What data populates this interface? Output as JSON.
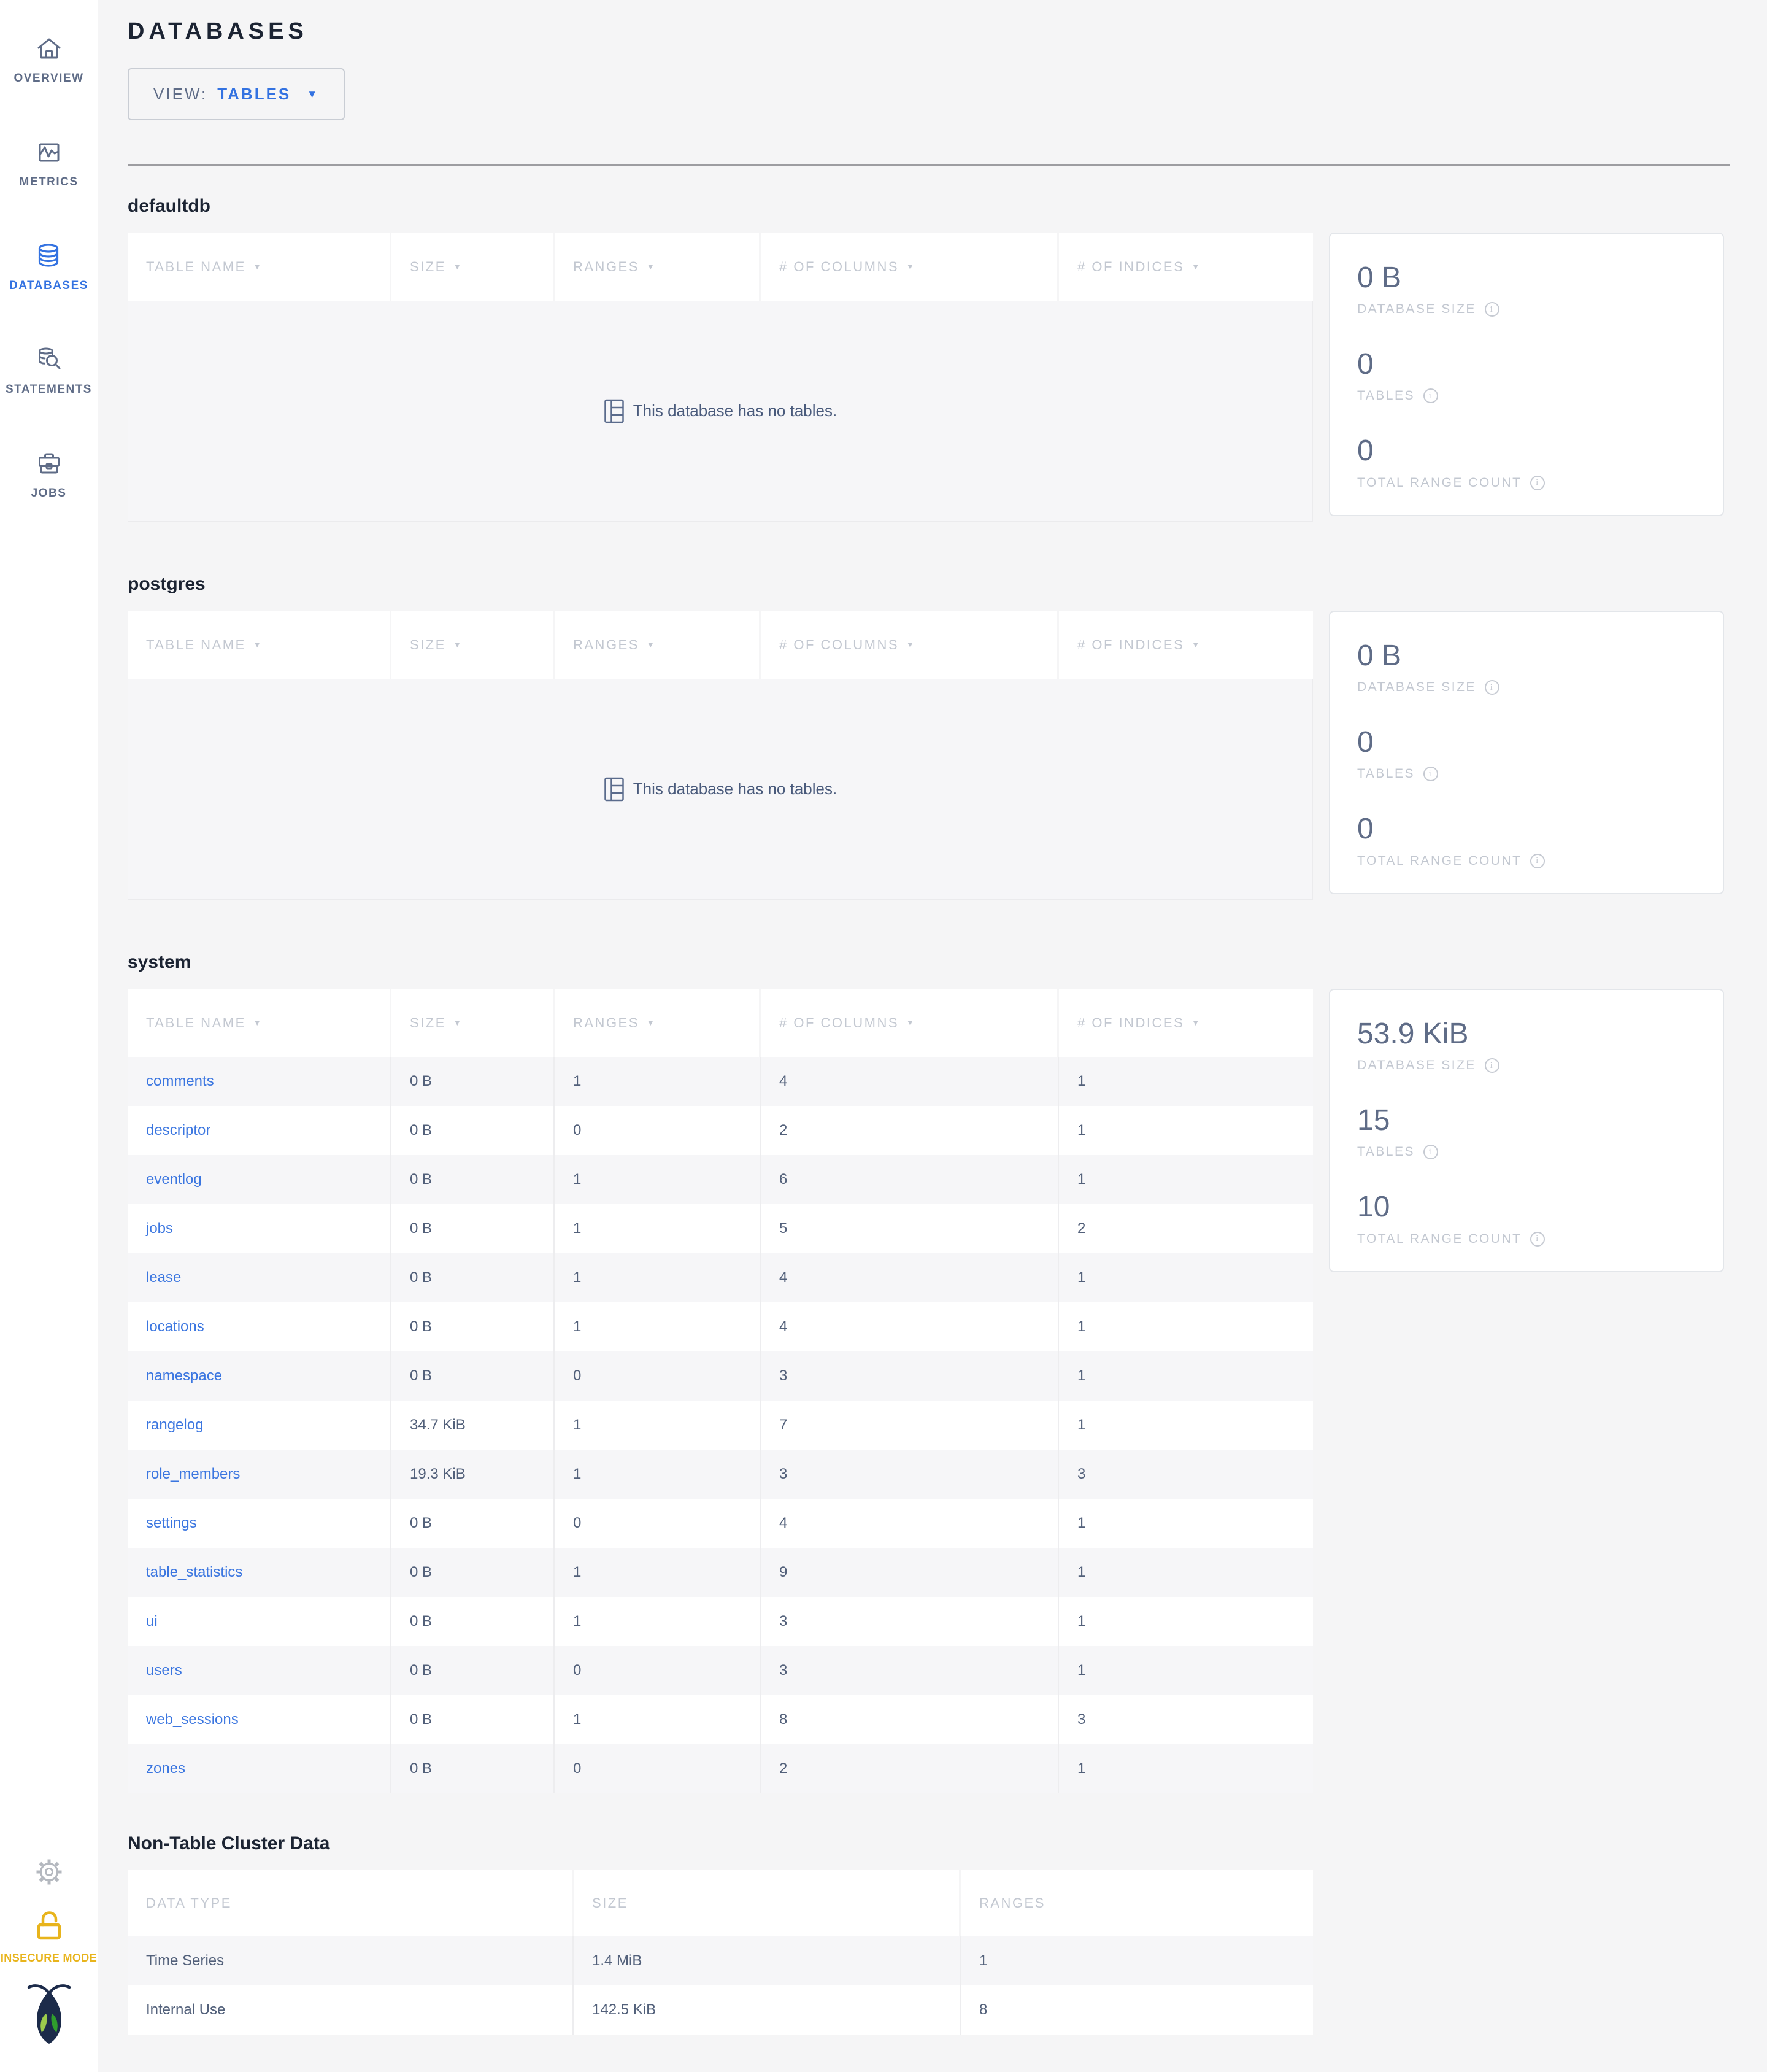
{
  "header": {
    "title": "DATABASES",
    "view_label": "VIEW:",
    "view_value": "TABLES"
  },
  "sidebar": {
    "items": [
      {
        "label": "OVERVIEW"
      },
      {
        "label": "METRICS"
      },
      {
        "label": "DATABASES"
      },
      {
        "label": "STATEMENTS"
      },
      {
        "label": "JOBS"
      }
    ],
    "insecure_mode_label": "INSECURE MODE"
  },
  "table_columns": {
    "table_name": "TABLE NAME",
    "size": "SIZE",
    "ranges": "RANGES",
    "num_columns": "# OF COLUMNS",
    "num_indices": "# OF INDICES"
  },
  "stats_labels": {
    "database_size": "DATABASE SIZE",
    "tables": "TABLES",
    "total_range_count": "TOTAL RANGE COUNT"
  },
  "empty_message": "This database has no tables.",
  "databases": [
    {
      "name": "defaultdb",
      "stats": {
        "size": "0 B",
        "tables": "0",
        "range_count": "0"
      }
    },
    {
      "name": "postgres",
      "stats": {
        "size": "0 B",
        "tables": "0",
        "range_count": "0"
      }
    },
    {
      "name": "system",
      "stats": {
        "size": "53.9 KiB",
        "tables": "15",
        "range_count": "10"
      },
      "rows": [
        {
          "name": "comments",
          "size": "0 B",
          "ranges": "1",
          "columns": "4",
          "indices": "1"
        },
        {
          "name": "descriptor",
          "size": "0 B",
          "ranges": "0",
          "columns": "2",
          "indices": "1"
        },
        {
          "name": "eventlog",
          "size": "0 B",
          "ranges": "1",
          "columns": "6",
          "indices": "1"
        },
        {
          "name": "jobs",
          "size": "0 B",
          "ranges": "1",
          "columns": "5",
          "indices": "2"
        },
        {
          "name": "lease",
          "size": "0 B",
          "ranges": "1",
          "columns": "4",
          "indices": "1"
        },
        {
          "name": "locations",
          "size": "0 B",
          "ranges": "1",
          "columns": "4",
          "indices": "1"
        },
        {
          "name": "namespace",
          "size": "0 B",
          "ranges": "0",
          "columns": "3",
          "indices": "1"
        },
        {
          "name": "rangelog",
          "size": "34.7 KiB",
          "ranges": "1",
          "columns": "7",
          "indices": "1"
        },
        {
          "name": "role_members",
          "size": "19.3 KiB",
          "ranges": "1",
          "columns": "3",
          "indices": "3"
        },
        {
          "name": "settings",
          "size": "0 B",
          "ranges": "0",
          "columns": "4",
          "indices": "1"
        },
        {
          "name": "table_statistics",
          "size": "0 B",
          "ranges": "1",
          "columns": "9",
          "indices": "1"
        },
        {
          "name": "ui",
          "size": "0 B",
          "ranges": "1",
          "columns": "3",
          "indices": "1"
        },
        {
          "name": "users",
          "size": "0 B",
          "ranges": "0",
          "columns": "3",
          "indices": "1"
        },
        {
          "name": "web_sessions",
          "size": "0 B",
          "ranges": "1",
          "columns": "8",
          "indices": "3"
        },
        {
          "name": "zones",
          "size": "0 B",
          "ranges": "0",
          "columns": "2",
          "indices": "1"
        }
      ]
    }
  ],
  "non_table": {
    "title": "Non-Table Cluster Data",
    "columns": {
      "data_type": "DATA TYPE",
      "size": "SIZE",
      "ranges": "RANGES"
    },
    "rows": [
      {
        "type": "Time Series",
        "size": "1.4 MiB",
        "ranges": "1"
      },
      {
        "type": "Internal Use",
        "size": "142.5 KiB",
        "ranges": "8"
      }
    ]
  },
  "colors": {
    "accent_blue": "#3372E1",
    "link_blue": "#3B76E0",
    "insecure_yellow": "#E8B41C",
    "logo_navy": "#1C2B4A",
    "logo_green_light": "#9BCB4C",
    "logo_green_dark": "#2F9E2C"
  }
}
